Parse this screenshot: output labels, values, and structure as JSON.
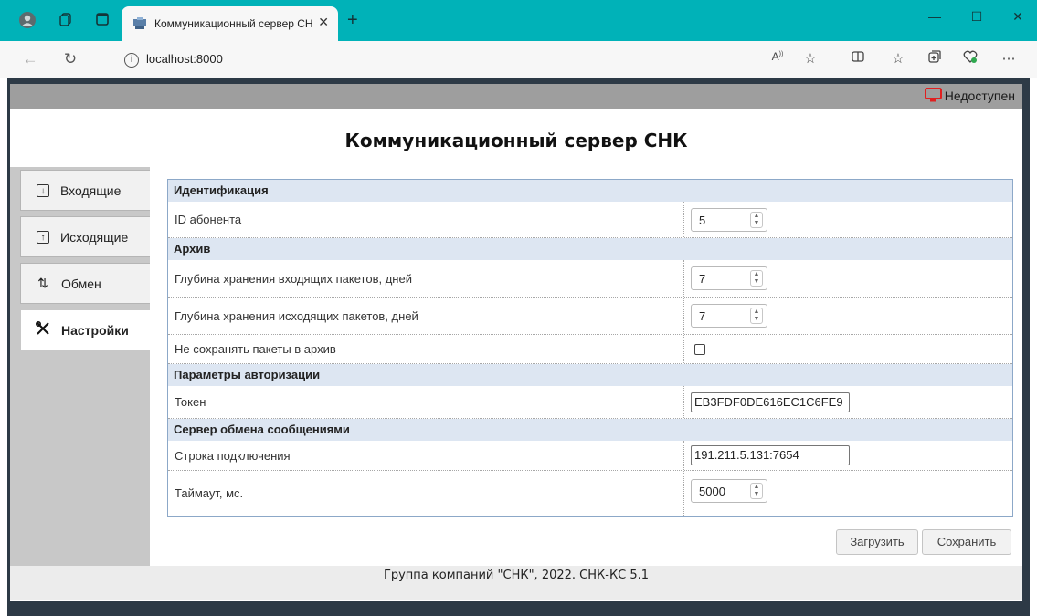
{
  "browser": {
    "tab_title": "Коммуникационный сервер СН",
    "url": "localhost:8000",
    "tab_close": "✕",
    "new_tab": "+"
  },
  "status": {
    "label": "Недоступен",
    "color": "#e02020"
  },
  "header": {
    "title": "Коммуникационный сервер СНК"
  },
  "sidebar": {
    "items": [
      {
        "label": "Входящие",
        "icon": "arrow-down-box-icon"
      },
      {
        "label": "Исходящие",
        "icon": "arrow-up-box-icon"
      },
      {
        "label": "Обмен",
        "icon": "exchange-icon"
      },
      {
        "label": "Настройки",
        "icon": "tools-icon",
        "active": true
      }
    ]
  },
  "settings": {
    "identification": {
      "title": "Идентификация",
      "subscriber_id_label": "ID абонента",
      "subscriber_id_value": "5"
    },
    "archive": {
      "title": "Архив",
      "incoming_depth_label": "Глубина хранения входящих пакетов, дней",
      "incoming_depth_value": "7",
      "outgoing_depth_label": "Глубина хранения исходящих пакетов, дней",
      "outgoing_depth_value": "7",
      "no_archive_label": "Не сохранять пакеты в архив",
      "no_archive_checked": false
    },
    "auth": {
      "title": "Параметры авторизации",
      "token_label": "Токен",
      "token_value": "EB3FDF0DE616EC1C6FE9"
    },
    "messaging": {
      "title": "Сервер обмена сообщениями",
      "connection_label": "Строка подключения",
      "connection_value": "191.211.5.131:7654",
      "timeout_label": "Таймаут, мс.",
      "timeout_value": "5000"
    }
  },
  "actions": {
    "load_label": "Загрузить",
    "save_label": "Сохранить"
  },
  "footer": {
    "text": "Группа компаний \"СНК\", 2022. СНК-КС 5.1"
  }
}
